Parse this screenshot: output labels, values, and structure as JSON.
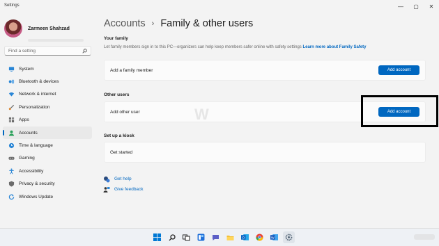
{
  "window": {
    "title": "Settings",
    "controls": {
      "minimize": "—",
      "maximize": "▢",
      "close": "✕"
    }
  },
  "profile": {
    "name": "Zarmeen Shahzad"
  },
  "search": {
    "placeholder": "Find a setting"
  },
  "sidebar": {
    "items": [
      {
        "label": "System",
        "icon": "monitor-icon",
        "color": "#2a86d6"
      },
      {
        "label": "Bluetooth & devices",
        "icon": "bluetooth-icon",
        "color": "#2a86d6"
      },
      {
        "label": "Network & internet",
        "icon": "wifi-icon",
        "color": "#2a86d6"
      },
      {
        "label": "Personalization",
        "icon": "brush-icon",
        "color": "#d9822b"
      },
      {
        "label": "Apps",
        "icon": "apps-icon",
        "color": "#6b6b6b"
      },
      {
        "label": "Accounts",
        "icon": "person-icon",
        "color": "#2aa05a",
        "active": true
      },
      {
        "label": "Time & language",
        "icon": "globe-clock-icon",
        "color": "#2a86d6"
      },
      {
        "label": "Gaming",
        "icon": "gamepad-icon",
        "color": "#6b6b6b"
      },
      {
        "label": "Accessibility",
        "icon": "accessibility-icon",
        "color": "#2a86d6"
      },
      {
        "label": "Privacy & security",
        "icon": "shield-icon",
        "color": "#6b6b6b"
      },
      {
        "label": "Windows Update",
        "icon": "update-icon",
        "color": "#2a86d6"
      }
    ]
  },
  "breadcrumb": {
    "parent": "Accounts",
    "separator": "›",
    "current": "Family & other users"
  },
  "family": {
    "title": "Your family",
    "description": "Let family members sign in to this PC—organizers can help keep members safer online with safety settings",
    "link": "Learn more about Family Safety",
    "card_label": "Add a family member",
    "button": "Add account"
  },
  "other_users": {
    "title": "Other users",
    "card_label": "Add other user",
    "button": "Add account"
  },
  "kiosk": {
    "title": "Set up a kiosk",
    "card_label": "Get started"
  },
  "help": {
    "get_help": "Get help",
    "give_feedback": "Give feedback"
  },
  "taskbar": {
    "icons": [
      "windows-start-icon",
      "search-icon",
      "task-view-icon",
      "widgets-icon",
      "chat-icon",
      "file-explorer-icon",
      "outlook-icon",
      "chrome-icon",
      "word-icon",
      "settings-icon"
    ]
  },
  "colors": {
    "accent": "#0067c0",
    "background": "#f3f3f3",
    "card": "#fbfbfb"
  }
}
